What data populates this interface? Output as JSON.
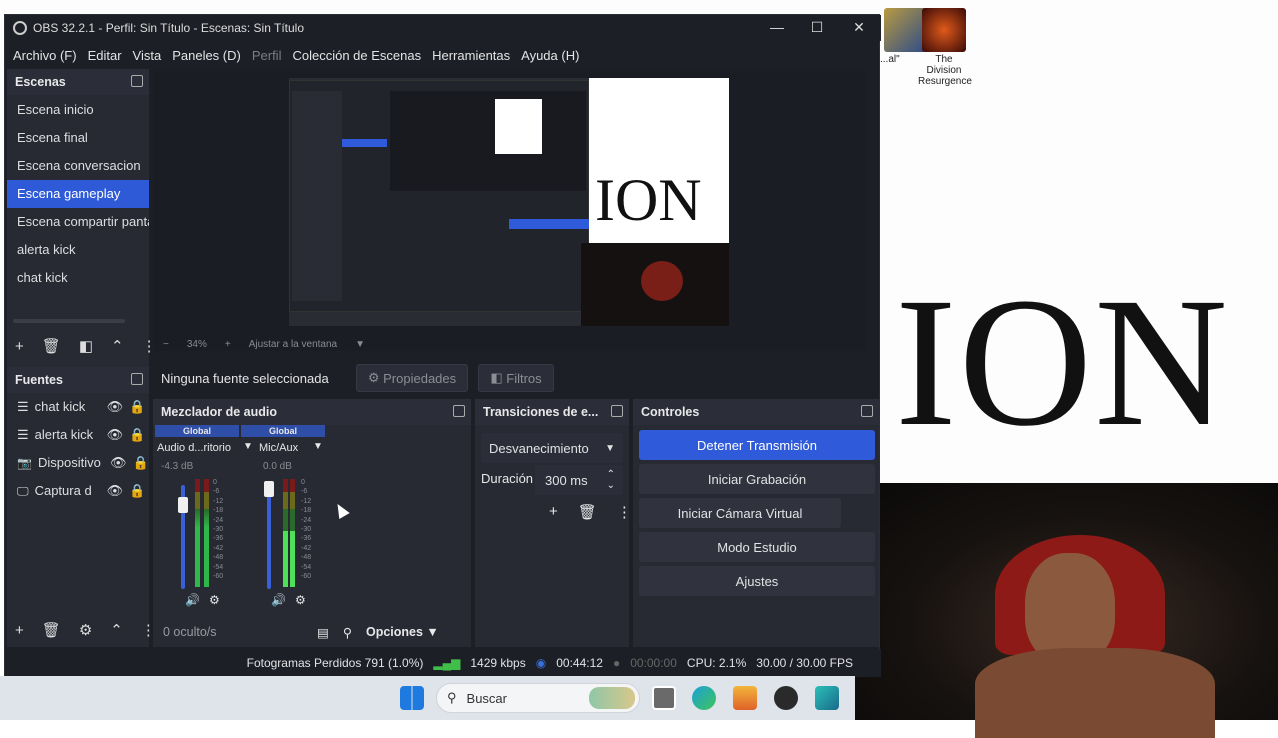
{
  "window": {
    "title": "OBS 32.2.1 - Perfil: Sin Título - Escenas: Sin Título",
    "min": "—",
    "max": "☐",
    "close": "✕"
  },
  "menu": [
    "Archivo (F)",
    "Editar",
    "Vista",
    "Paneles (D)",
    "Perfil",
    "Colección de Escenas",
    "Herramientas",
    "Ayuda (H)"
  ],
  "scenes": {
    "title": "Escenas",
    "items": [
      "Escena inicio",
      "Escena  final",
      "Escena conversacion",
      "Escena gameplay",
      "Escena compartir pantalla",
      "alerta kick",
      "chat kick"
    ],
    "selected": "Escena gameplay"
  },
  "sources": {
    "title": "Fuentes",
    "items": [
      {
        "icon": "list-icon",
        "label": "chat kick"
      },
      {
        "icon": "list-icon",
        "label": "alerta kick"
      },
      {
        "icon": "camera-icon",
        "label": "Dispositivo"
      },
      {
        "icon": "monitor-icon",
        "label": "Captura d"
      }
    ]
  },
  "preview": {
    "zoom": "34%",
    "fit": "Ajustar a la ventana",
    "ion_text": "ION"
  },
  "source_toolbar": {
    "none_selected": "Ninguna fuente seleccionada",
    "properties": "Propiedades",
    "filters": "Filtros"
  },
  "mixer": {
    "title": "Mezclador de audio",
    "channels": [
      {
        "badge": "Global",
        "name": "Audio d...ritorio",
        "db": "-4.3 dB",
        "fader": 0.72
      },
      {
        "badge": "Global",
        "name": "Mic/Aux",
        "db": "0.0 dB",
        "fader": 0.85
      }
    ],
    "ticks": [
      "0",
      "-6",
      "-12",
      "-18",
      "-24",
      "-30",
      "-36",
      "-42",
      "-48",
      "-54",
      "-60"
    ],
    "hidden": "0 oculto/s",
    "options": "Opciones"
  },
  "transitions": {
    "title": "Transiciones de e...",
    "selected": "Desvanecimiento",
    "duration_label": "Duración",
    "duration_value": "300 ms"
  },
  "controls": {
    "title": "Controles",
    "stop_stream": "Detener Transmisión",
    "start_record": "Iniciar Grabación",
    "virtual_cam": "Iniciar Cámara Virtual",
    "studio": "Modo Estudio",
    "settings": "Ajustes"
  },
  "status": {
    "dropped": "Fotogramas Perdidos 791 (1.0%)",
    "kbps": "1429 kbps",
    "live_time": "00:44:12",
    "rec_time": "00:00:00",
    "cpu": "CPU: 2.1%",
    "fps": "30.00 / 30.00 FPS"
  },
  "desktop": {
    "icon_label": "The Division Resurgence",
    "partial_label": "...al\"",
    "ion_text": "ION"
  },
  "taskbar": {
    "search": "Buscar"
  },
  "colors": {
    "accent": "#2f5ad9",
    "panel": "#272a33",
    "bg": "#1d1f26"
  }
}
